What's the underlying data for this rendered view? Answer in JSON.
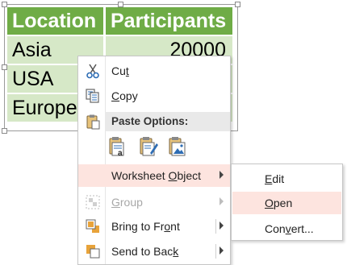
{
  "table": {
    "headers": [
      "Location",
      "Participants"
    ],
    "rows": [
      [
        "Asia",
        "20000"
      ],
      [
        "USA",
        ""
      ],
      [
        "Europe",
        ""
      ]
    ]
  },
  "menu": {
    "cut": {
      "pre": "Cu",
      "key": "t",
      "post": ""
    },
    "copy": {
      "pre": "",
      "key": "C",
      "post": "opy"
    },
    "paste_header": "Paste Options:",
    "worksheet_object": {
      "pre": "Worksheet ",
      "key": "O",
      "post": "bject"
    },
    "group": {
      "pre": "",
      "key": "G",
      "post": "roup"
    },
    "bring_to_front": {
      "pre": "Bring to Fr",
      "key": "o",
      "post": "nt"
    },
    "send_to_back": {
      "pre": "Send to Bac",
      "key": "k",
      "post": ""
    }
  },
  "submenu": {
    "edit": {
      "pre": "",
      "key": "E",
      "post": "dit"
    },
    "open": {
      "pre": "",
      "key": "O",
      "post": "pen"
    },
    "convert": {
      "pre": "Con",
      "key": "v",
      "post": "ert..."
    }
  },
  "colors": {
    "header_bg": "#6fac46",
    "cell_bg": "#d6e8c7",
    "highlight": "#fde4df"
  },
  "icons": {
    "cut": "scissors-icon",
    "copy": "copy-icon",
    "paste": "clipboard-icon",
    "group": "group-icon",
    "bring_to_front": "bring-to-front-icon",
    "send_to_back": "send-to-back-icon"
  }
}
